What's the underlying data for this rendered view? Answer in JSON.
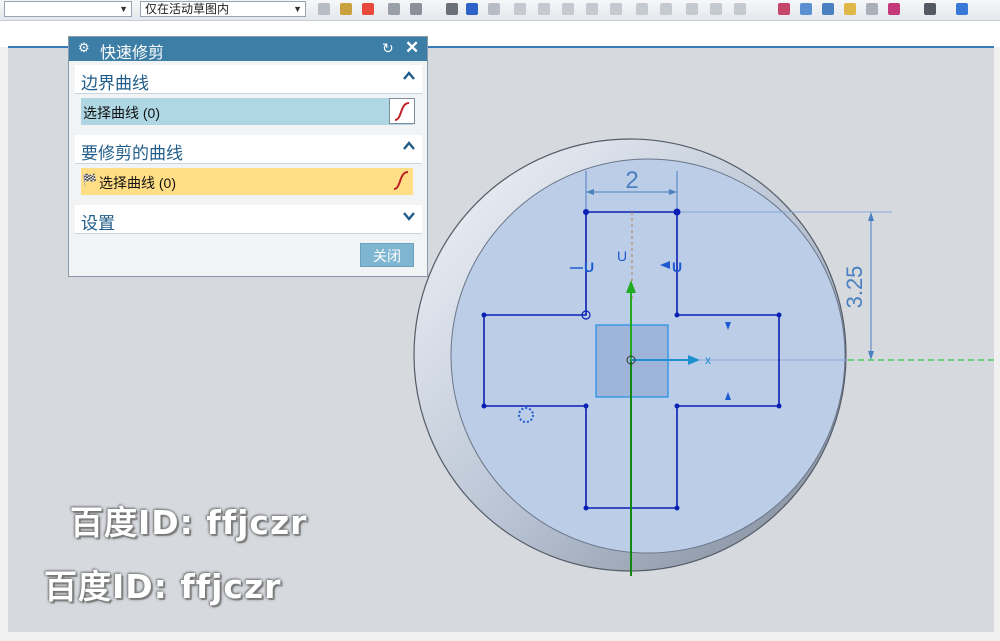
{
  "toolbar": {
    "scope_select": "",
    "sketch_select": "仅在活动草图内"
  },
  "dialog": {
    "title": "快速修剪",
    "boundary_section": {
      "title": "边界曲线",
      "select_label": "选择曲线 (0)"
    },
    "trim_section": {
      "title": "要修剪的曲线",
      "select_label": "选择曲线 (0)"
    },
    "settings_section": {
      "title": "设置"
    },
    "close_label": "关闭"
  },
  "sketch": {
    "dimension_width": "2",
    "dimension_height": "3.25",
    "x_axis_label": "x",
    "y_axis_label": "U"
  },
  "watermark": {
    "line1": "百度ID: ffjczr",
    "line2": "百度ID: ffjczr"
  },
  "colors": {
    "title_bar": "#3d7ea6",
    "active_row": "#aed7e3",
    "highlight_row": "#ffde85",
    "sketch_line": "#0a1fb4",
    "face": "#bccde8"
  }
}
